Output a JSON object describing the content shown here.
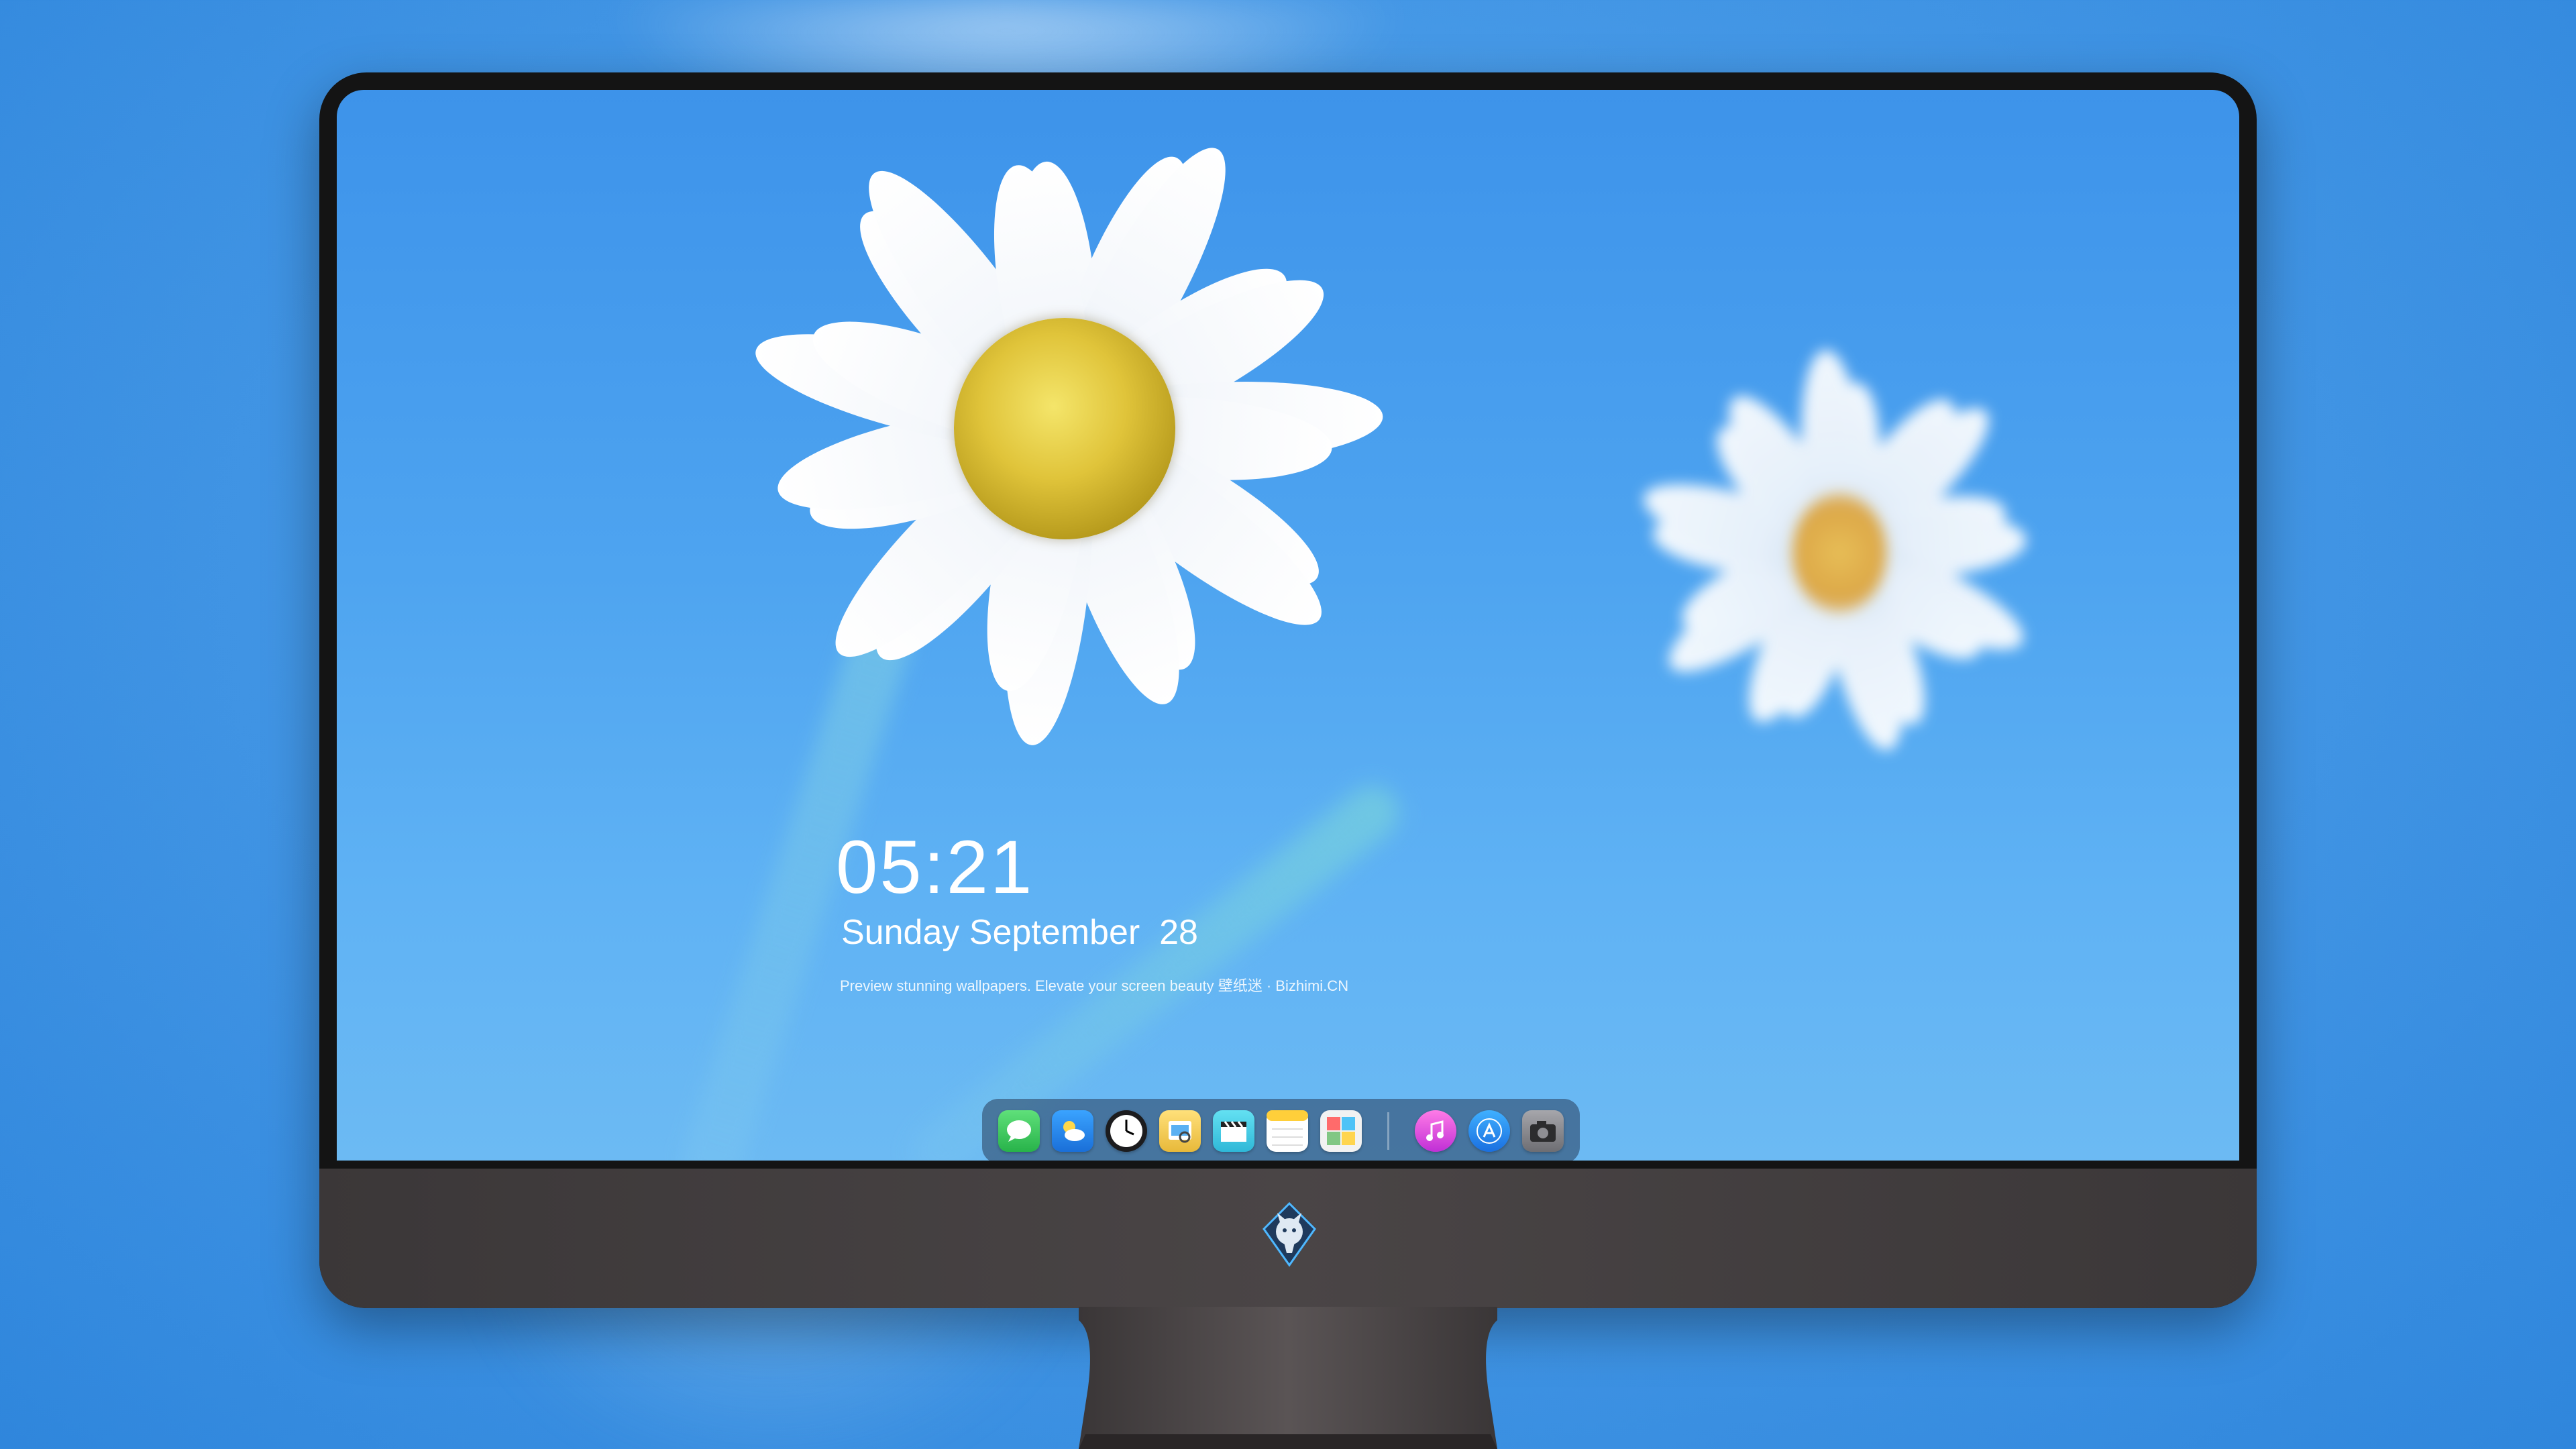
{
  "lock_screen": {
    "time": "05:21",
    "date": "Sunday September  28",
    "tagline": "Preview stunning wallpapers. Elevate your screen beauty 壁纸迷 · Bizhimi.CN"
  },
  "dock": {
    "apps": [
      {
        "icon": "messages-icon",
        "color": "#34c759"
      },
      {
        "icon": "weather-icon",
        "color": "#2f8ff0"
      },
      {
        "icon": "clock-icon",
        "color": "#1c1c1e"
      },
      {
        "icon": "preview-icon",
        "color": "#f2c94c"
      },
      {
        "icon": "clips-icon",
        "color": "#4fd1e8"
      },
      {
        "icon": "notes-icon",
        "color": "#ffd54a"
      },
      {
        "icon": "photo-booth-icon",
        "color": "#f5f5f5"
      },
      {
        "icon": "music-icon",
        "color": "#ff4fd8"
      },
      {
        "icon": "app-store-icon",
        "color": "#2c8cf4"
      },
      {
        "icon": "camera-icon",
        "color": "#8e8e93"
      }
    ]
  },
  "colors": {
    "wallpaper_sky": "#4ea4f0",
    "bezel": "#141414",
    "chin": "#443f40"
  }
}
